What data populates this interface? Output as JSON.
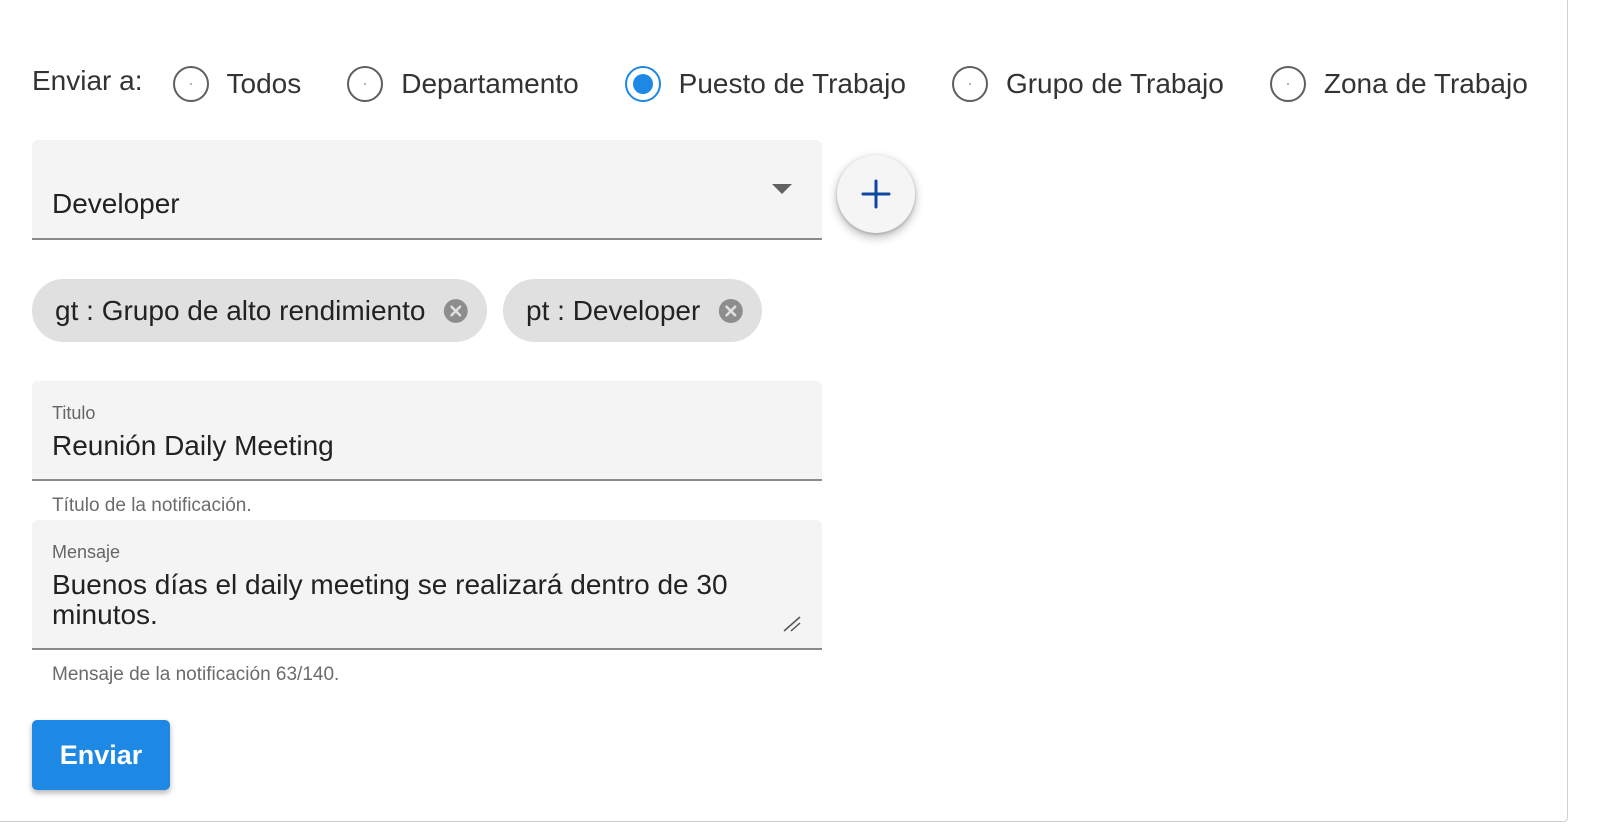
{
  "send_to": {
    "label": "Enviar a:",
    "options": [
      {
        "label": "Todos",
        "checked": false
      },
      {
        "label": "Departamento",
        "checked": false
      },
      {
        "label": "Puesto de Trabajo",
        "checked": true
      },
      {
        "label": "Grupo de Trabajo",
        "checked": false
      },
      {
        "label": "Zona de Trabajo",
        "checked": false
      }
    ]
  },
  "select": {
    "value": "Developer"
  },
  "chips": [
    {
      "label": "gt : Grupo de alto rendimiento"
    },
    {
      "label": "pt : Developer"
    }
  ],
  "title_field": {
    "label": "Titulo",
    "value": "Reunión Daily Meeting",
    "helper": "Título de la notificación."
  },
  "message_field": {
    "label": "Mensaje",
    "value_line1": "Buenos días el daily meeting se realizará dentro de 30",
    "value_line2": "minutos.",
    "helper": "Mensaje de la notificación 63/140."
  },
  "submit": {
    "label": "Enviar"
  },
  "colors": {
    "accent": "#1e88e5",
    "fab_icon": "#0d47a1",
    "field_bg": "#f4f4f4",
    "chip_bg": "#e0e0e0"
  },
  "icons": {
    "fab": "plus-icon",
    "chip_remove": "cancel-circle-icon",
    "select_caret": "caret-down-icon"
  }
}
